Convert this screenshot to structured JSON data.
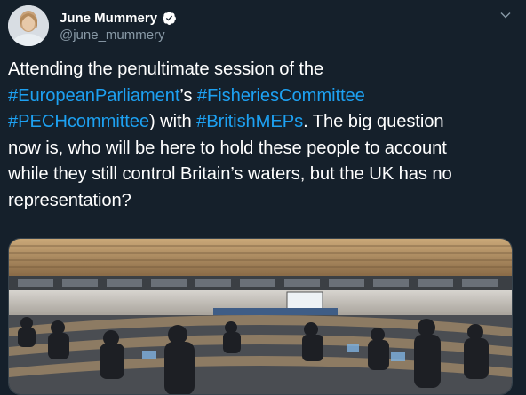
{
  "author": {
    "display_name": "June Mummery",
    "handle": "@june_mummery",
    "verified": true,
    "avatar_icon": "profile-photo"
  },
  "menu_icon": "chevron-down-icon",
  "tweet": {
    "lines": [
      [
        {
          "t": "Attending the penultimate session of the",
          "h": false
        }
      ],
      [
        {
          "t": "#EuropeanParliament",
          "h": true
        },
        {
          "t": "’s ",
          "h": false
        },
        {
          "t": "#FisheriesCommittee",
          "h": true
        }
      ],
      [
        {
          "t": "#PECHcommittee",
          "h": true
        },
        {
          "t": ") with ",
          "h": false
        },
        {
          "t": "#BritishMEPs",
          "h": true
        },
        {
          "t": ". The big question",
          "h": false
        }
      ],
      [
        {
          "t": "now is, who will be here to hold these people to account",
          "h": false
        }
      ],
      [
        {
          "t": "while they still control Britain’s waters, but the UK has no",
          "h": false
        }
      ],
      [
        {
          "t": "representation?",
          "h": false
        }
      ]
    ]
  },
  "media": {
    "type": "photo",
    "description_icon": "committee-room-photo"
  },
  "colors": {
    "background": "#15202b",
    "text": "#ffffff",
    "secondary_text": "#8899a6",
    "hashtag": "#1da1f2",
    "verified_badge": "#ffffff"
  }
}
